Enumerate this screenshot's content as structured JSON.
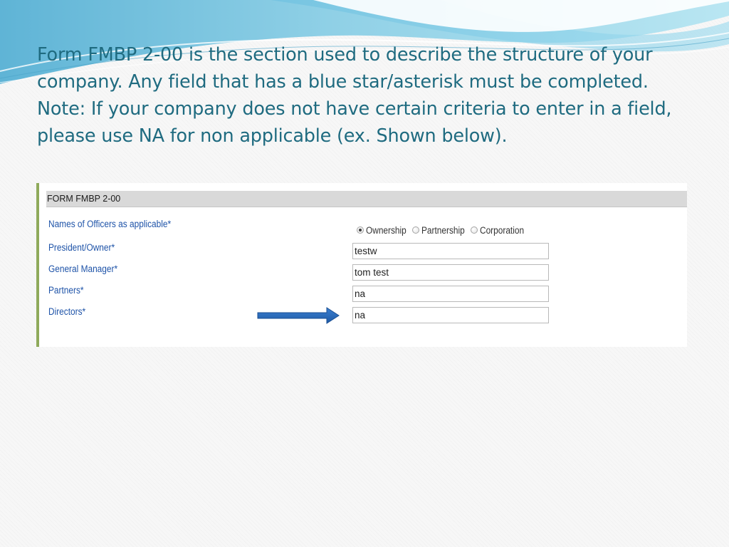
{
  "intro": {
    "line1": "Form FMBP 2-00 is the section used to describe the structure of your",
    "line2": "company. Any field that has a blue star/asterisk must be completed.",
    "line3": "Note: If your company does not have certain criteria to enter in a field,",
    "line4": "please use NA for non applicable (ex. Shown below)."
  },
  "form": {
    "header": "FORM FMBP 2-00",
    "officers_label": "Names of Officers as applicable*",
    "radio_options": [
      "Ownership",
      "Partnership",
      "Corporation"
    ],
    "selected_option": "Ownership",
    "fields": [
      {
        "label": "President/Owner*",
        "value": "testw"
      },
      {
        "label": "General Manager*",
        "value": "tom test"
      },
      {
        "label": "Partners*",
        "value": "na"
      },
      {
        "label": "Directors*",
        "value": "na"
      }
    ]
  },
  "colors": {
    "intro_text": "#1f6b80",
    "label_blue": "#1e53a8",
    "arrow_blue": "#2b6bbf",
    "panel_border": "#8faa5b",
    "header_gray": "#d9d9d9"
  },
  "icons": {
    "arrow": "right-arrow-icon"
  }
}
